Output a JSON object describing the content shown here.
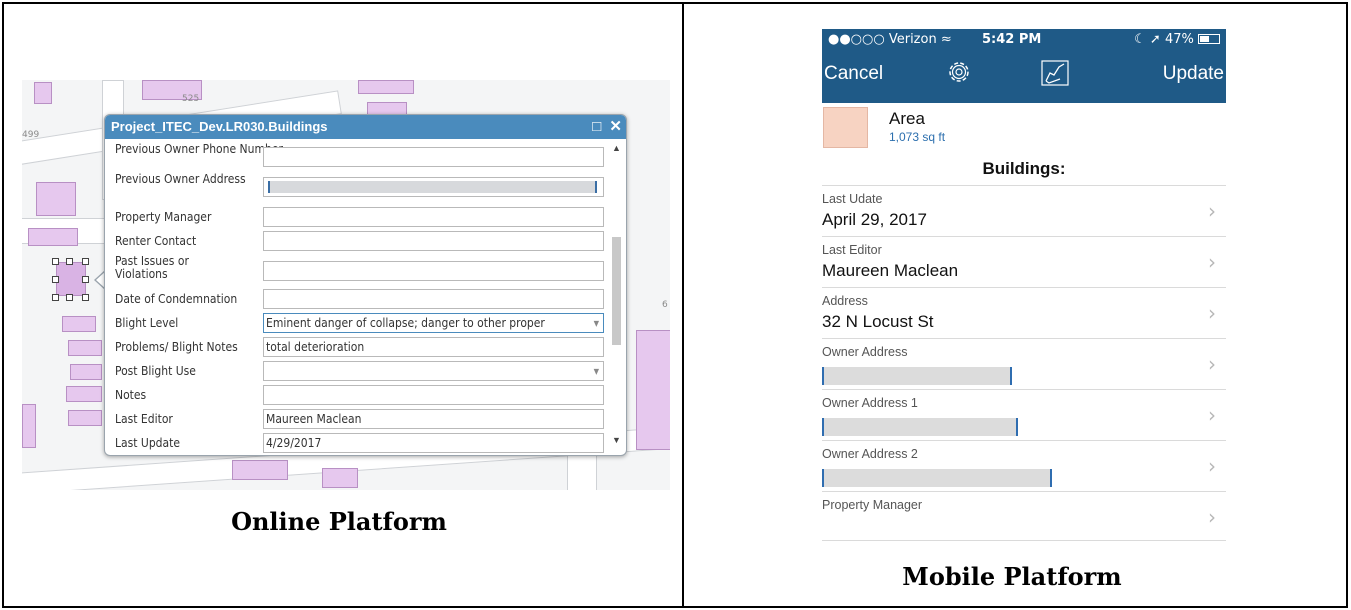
{
  "captions": {
    "online": "Online Platform",
    "mobile": "Mobile Platform"
  },
  "map": {
    "labels": [
      "525",
      "499",
      "6"
    ],
    "popup": {
      "title": "Project_ITEC_Dev.LR030.Buildings",
      "fields": [
        {
          "label": "Previous Owner Phone Number",
          "value": ""
        },
        {
          "label": "Previous Owner Address",
          "value": "",
          "redacted": true
        },
        {
          "label": "Property Manager",
          "value": ""
        },
        {
          "label": "Renter Contact",
          "value": ""
        },
        {
          "label": "Past Issues or Violations",
          "value": ""
        },
        {
          "label": "Date of Condemnation",
          "value": ""
        },
        {
          "label": "Blight Level",
          "value": "Eminent danger of collapse; danger to other proper",
          "dropdown": true
        },
        {
          "label": "Problems/ Blight Notes",
          "value": "total deterioration"
        },
        {
          "label": "Post Blight Use",
          "value": "",
          "dropdown": true
        },
        {
          "label": "Notes",
          "value": ""
        },
        {
          "label": "Last Editor",
          "value": "Maureen Maclean"
        },
        {
          "label": "Last Update",
          "value": "4/29/2017"
        }
      ]
    }
  },
  "mobile": {
    "status": {
      "carrier": "●●○○○ Verizon",
      "time": "5:42 PM",
      "battery": "47%"
    },
    "nav": {
      "cancel": "Cancel",
      "update": "Update"
    },
    "area": {
      "title": "Area",
      "value": "1,073 sq ft",
      "color": "#f7d3c2"
    },
    "section": "Buildings:",
    "fields": [
      {
        "label": "Last Udate",
        "value": "April 29, 2017"
      },
      {
        "label": "Last Editor",
        "value": "Maureen Maclean"
      },
      {
        "label": "Address",
        "value": "32 N Locust St"
      },
      {
        "label": "Owner Address",
        "value": "",
        "redacted": true
      },
      {
        "label": "Owner Address 1",
        "value": "",
        "redacted": true
      },
      {
        "label": "Owner Address 2",
        "value": "",
        "redacted": true
      },
      {
        "label": "Property Manager",
        "value": ""
      }
    ]
  },
  "colors": {
    "header_blue": "#4a8bbd",
    "mobile_blue": "#1f5a87",
    "building": "#e6c8ee"
  }
}
